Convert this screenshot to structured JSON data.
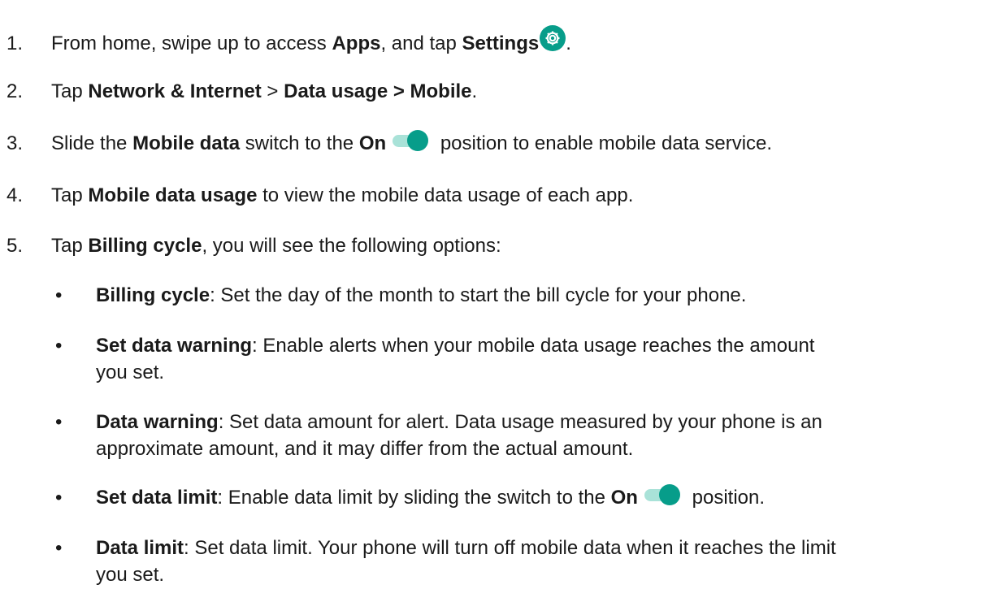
{
  "steps": [
    {
      "num": "1.",
      "p1": "From home, swipe up to access ",
      "b1": "Apps",
      "p2": ", and tap ",
      "b2": "Settings",
      "p3": "."
    },
    {
      "num": "2.",
      "p1": "Tap ",
      "b1": "Network & Internet",
      "p2": " > ",
      "b2": "Data usage > Mobile",
      "p3": "."
    },
    {
      "num": "3.",
      "p1": "Slide the ",
      "b1": "Mobile data",
      "p2": " switch to the ",
      "b2": "On",
      "p3": " position to enable mobile data service."
    },
    {
      "num": "4.",
      "p1": "Tap ",
      "b1": "Mobile data usage",
      "p2": " to view the mobile data usage of each app."
    },
    {
      "num": "5.",
      "p1": "Tap ",
      "b1": "Billing cycle",
      "p2": ", you will see the following options:"
    }
  ],
  "bullets": [
    {
      "dot": "•",
      "b1": "Billing cycle",
      "p1": ": Set the day of the month to start the bill cycle for your phone."
    },
    {
      "dot": "•",
      "b1": "Set data warning",
      "p1": ": Enable alerts when your mobile data usage reaches the amount",
      "p2": "you set."
    },
    {
      "dot": "•",
      "b1": "Data warning",
      "p1": ": Set data amount for alert. Data usage measured by your phone is an",
      "p2": "approximate amount, and it may differ from the actual amount."
    },
    {
      "dot": "•",
      "b1": "Set data limit",
      "p1": ": Enable data limit by sliding the switch to the ",
      "b2": "On",
      "p3": " position."
    },
    {
      "dot": "•",
      "b1": "Data limit",
      "p1": ": Set data limit. Your phone will turn off mobile data when it reaches the limit",
      "p2": "you set."
    }
  ],
  "icons": {
    "settings": "settings-gear-icon",
    "toggle": "toggle-on-icon",
    "accent": "#079d8a",
    "accent_light": "#a9e2d8"
  }
}
